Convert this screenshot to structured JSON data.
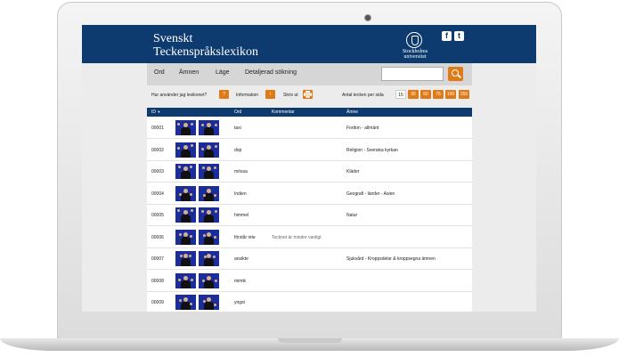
{
  "header": {
    "title_line1": "Svenskt",
    "title_line2": "Teckenspråkslexikon",
    "logo_line1": "Stockholms",
    "logo_line2": "universitet",
    "social_facebook": "f",
    "social_twitter": "t",
    "brand_color": "#0d3a6f"
  },
  "nav": {
    "items": [
      {
        "label": "Ord"
      },
      {
        "label": "Ämnen"
      },
      {
        "label": "Läge"
      },
      {
        "label": "Detaljerad sökning"
      }
    ],
    "search_placeholder": "",
    "accent_color": "#e07a16"
  },
  "toolbar": {
    "help_label": "Hur använder jag lexikonet?",
    "help_btn": "?",
    "info_label": "Information",
    "info_btn": "i",
    "print_label": "Skriv ut",
    "page_size_label": "Antal tecken per sida",
    "page_sizes": [
      "15",
      "30",
      "50",
      "75",
      "100",
      "250"
    ],
    "page_size_selected": "15"
  },
  "table": {
    "columns": [
      "ID",
      "Ord",
      "Kommentar",
      "Ämne"
    ],
    "sort_indicator": "▼",
    "rows": [
      {
        "id": "00001",
        "ord": "taxi",
        "kommentar": "",
        "amne": "Fordon - allmänt"
      },
      {
        "id": "00002",
        "ord": "dop",
        "kommentar": "",
        "amne": "Religion - Svenska kyrkan"
      },
      {
        "id": "00003",
        "ord": "mössa",
        "kommentar": "",
        "amne": "Kläder"
      },
      {
        "id": "00004",
        "ord": "Indien",
        "kommentar": "",
        "amne": "Geografi - länder - Asien"
      },
      {
        "id": "00005",
        "ord": "himmel",
        "kommentar": "",
        "amne": "Natur"
      },
      {
        "id": "00006",
        "ord": "förstår inte",
        "kommentar": "Tecknet är mindre vanligt",
        "amne": ""
      },
      {
        "id": "00007",
        "ord": "ansikte",
        "kommentar": "",
        "amne": "Sjukvård - Kroppsdelar & kroppsegna ämnen"
      },
      {
        "id": "00008",
        "ord": "mimik",
        "kommentar": "",
        "amne": ""
      },
      {
        "id": "00009",
        "ord": "yngst",
        "kommentar": "",
        "amne": ""
      }
    ]
  }
}
